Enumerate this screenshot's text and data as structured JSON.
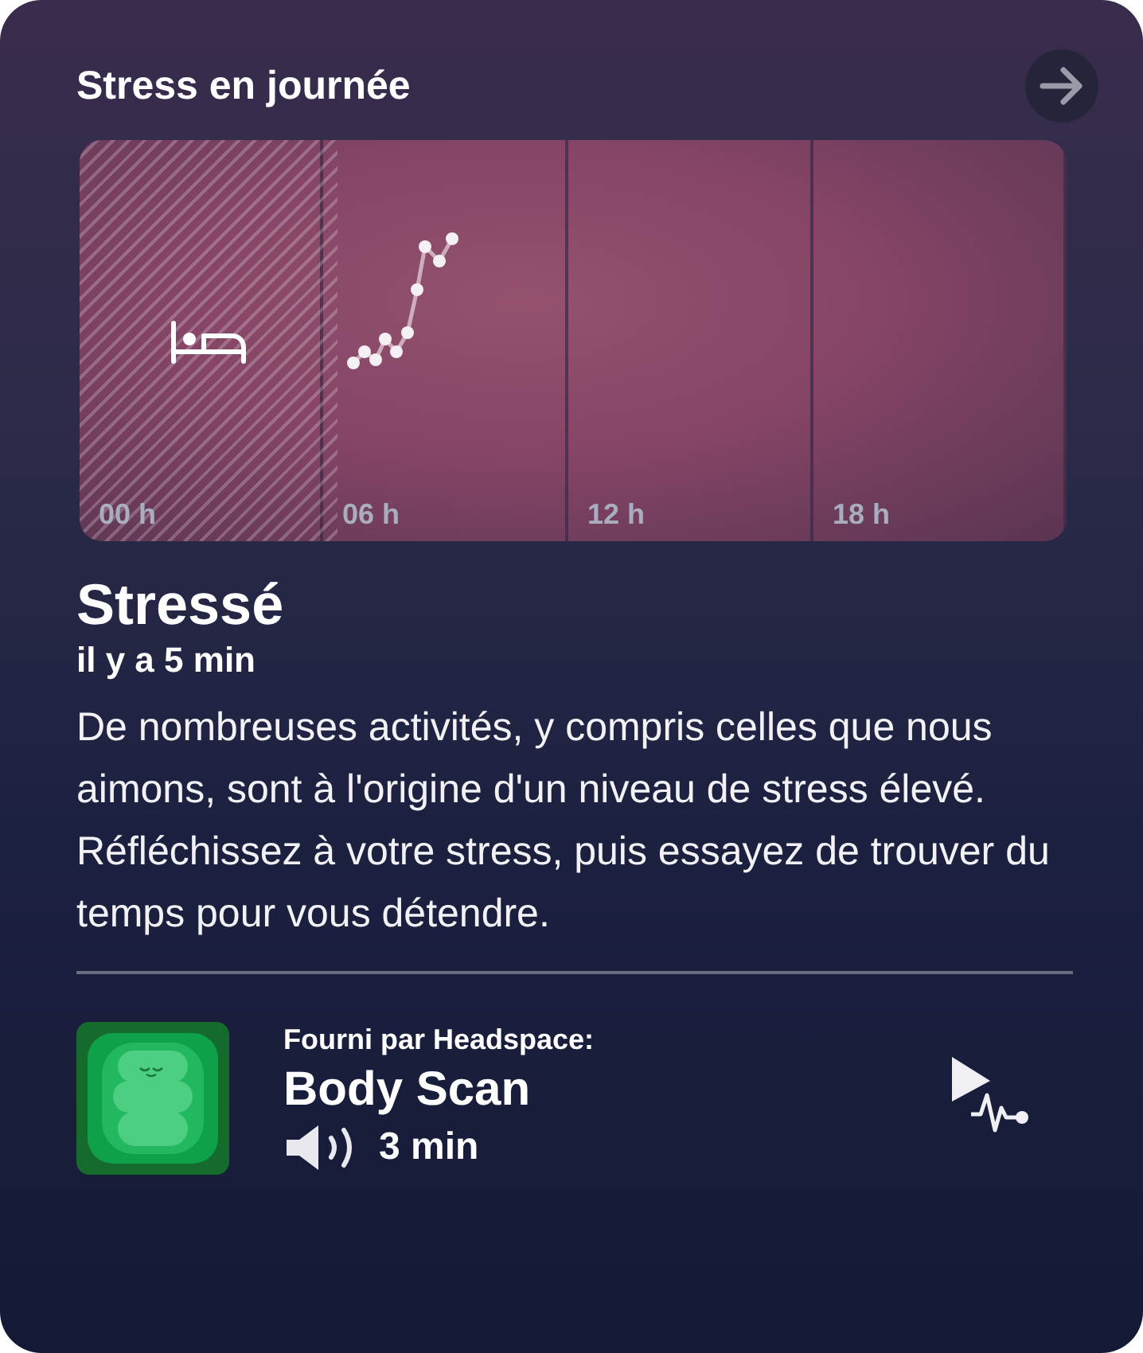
{
  "title": "Stress en journée",
  "hour_labels": [
    "00 h",
    "06 h",
    "12 h",
    "18 h"
  ],
  "status": "Stressé",
  "time_ago": "il y a 5 min",
  "description": "De nombreuses activités, y compris celles que nous aimons, sont à l'origine d'un niveau de stress élevé. Réfléchissez à votre stress, puis essayez de trouver du temps pour vous détendre.",
  "session": {
    "provider": "Fourni par Headspace:",
    "title": "Body Scan",
    "duration": "3 min"
  }
}
